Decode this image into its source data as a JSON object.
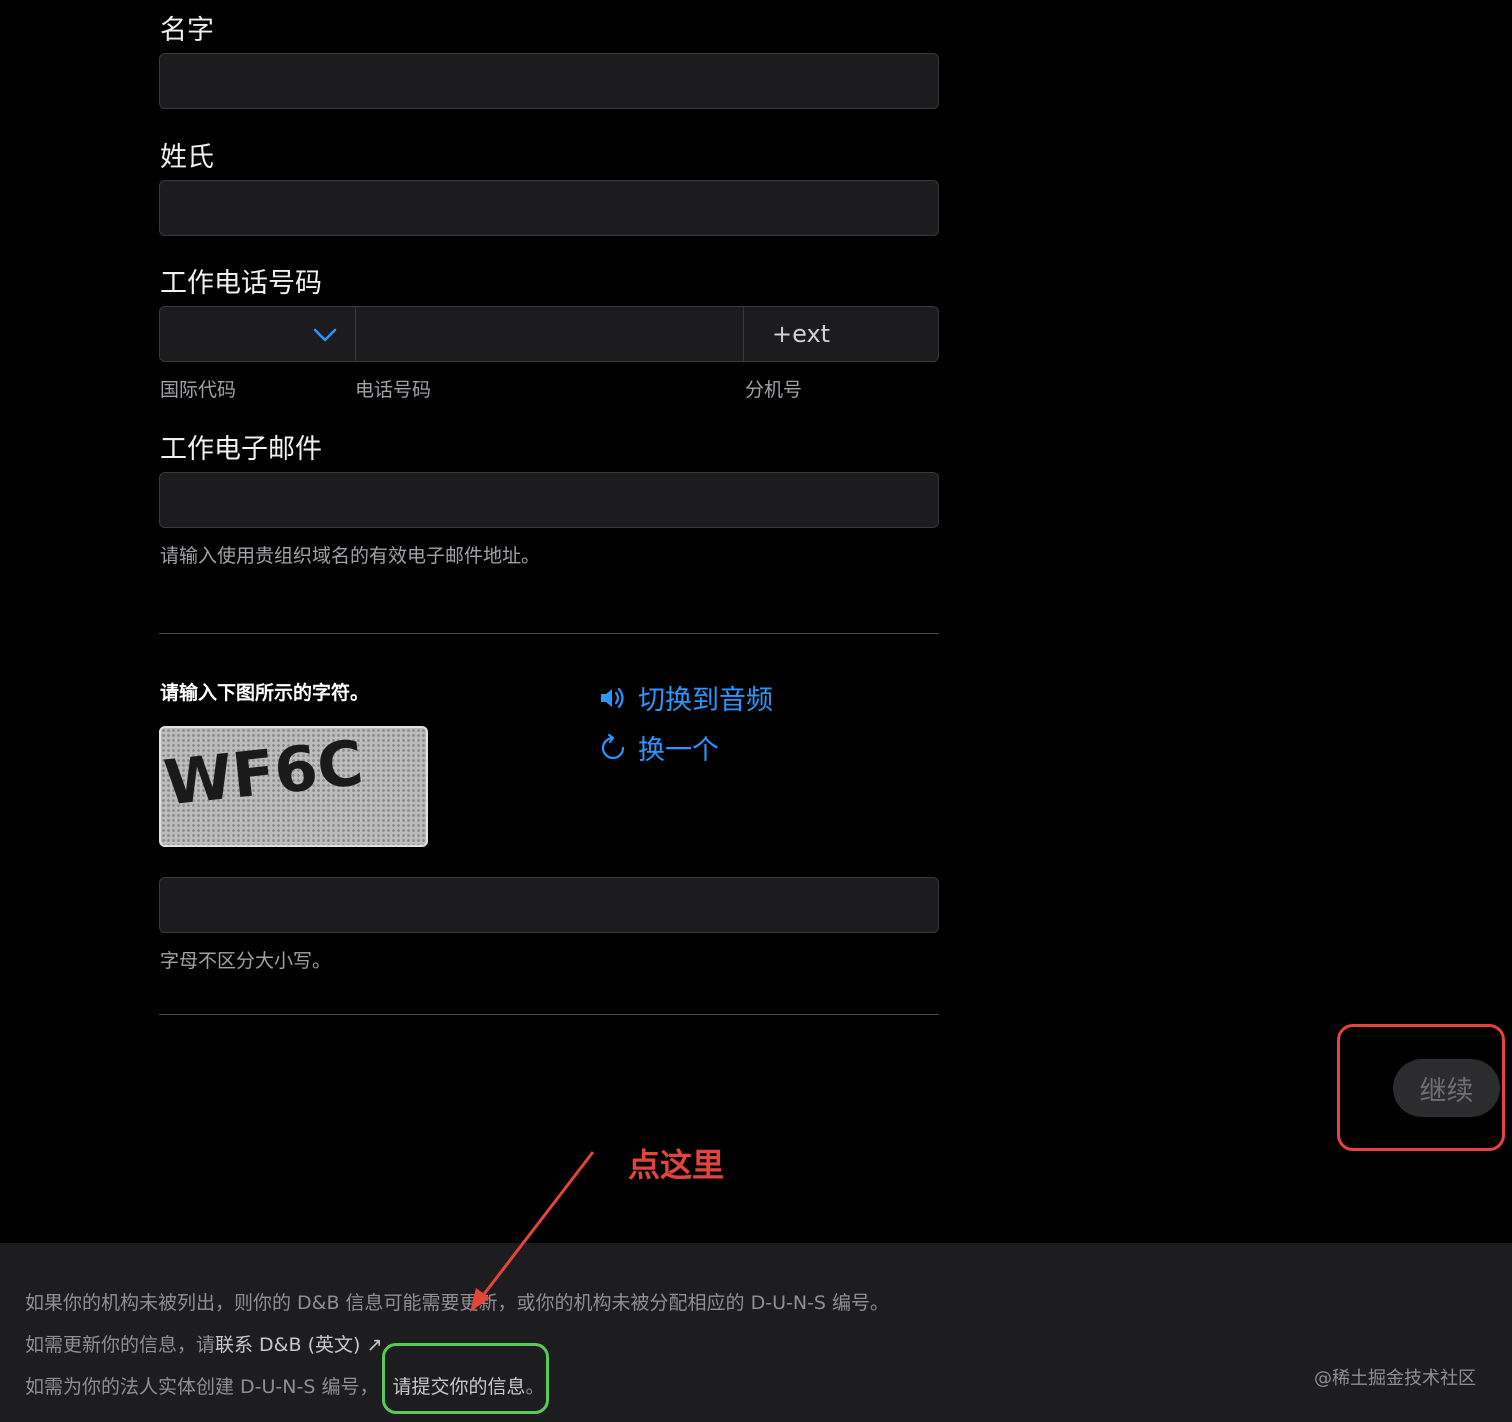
{
  "form": {
    "first_name_label": "名字",
    "last_name_label": "姓氏",
    "work_phone_label": "工作电话号码",
    "phone": {
      "ext_placeholder": "+ext",
      "country_code_caption": "国际代码",
      "number_caption": "电话号码",
      "ext_caption": "分机号"
    },
    "work_email_label": "工作电子邮件",
    "work_email_hint": "请输入使用贵组织域名的有效电子邮件地址。"
  },
  "captcha": {
    "title": "请输入下图所示的字符。",
    "image_text": "WF6C",
    "audio_link": "切换到音频",
    "refresh_link": "换一个",
    "hint": "字母不区分大小写。"
  },
  "continue_button": "继续",
  "annotation": {
    "text": "点这里",
    "color": "#e5443a"
  },
  "footer": {
    "line1": "如果你的机构未被列出，则你的 D&B 信息可能需要更新，或你的机构未被分配相应的 D-U-N-S 编号。",
    "line2_prefix": "如需更新你的信息，请",
    "line2_link": "联系 D&B (英文)",
    "line2_arrow": "↗",
    "line3_prefix": "如需为你的法人实体创建 D-U-N-S 编号，",
    "line3_link": "请提交你的信息",
    "line3_suffix": "。"
  },
  "watermark": "@稀土掘金技术社区",
  "colors": {
    "link": "#2997ff",
    "background": "#000000",
    "footer_bg": "#1d1d1f",
    "highlight_red": "#e5443a",
    "highlight_green": "#5ac85a"
  }
}
